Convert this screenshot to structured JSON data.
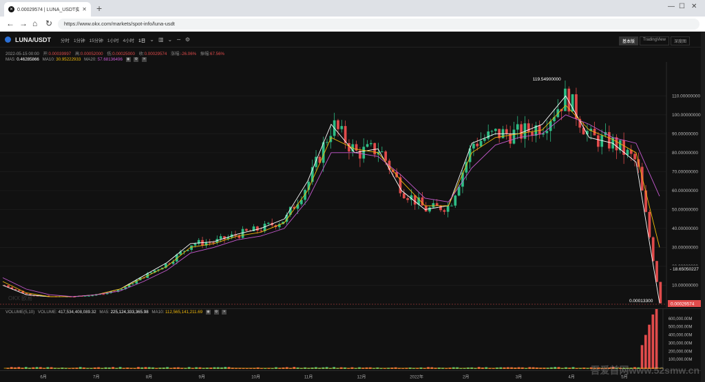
{
  "browser": {
    "tab_title": "0.00029574 | LUNA_USDT实时行情",
    "url": "https://www.okx.com/markets/spot-info/luna-usdt",
    "new_tab": "+",
    "minimize": "—",
    "maximize": "☐",
    "close": "✕"
  },
  "toolbar": {
    "symbol": "LUNA/USDT",
    "intervals": [
      "分时",
      "1分钟",
      "15分钟",
      "1小时",
      "4小时",
      "1日"
    ],
    "active_interval": "1日",
    "views": [
      "基本版",
      "TradingView",
      "深度图"
    ],
    "active_view": "基本版"
  },
  "ohlc": {
    "date": "2022-05-15 00:00",
    "open_label": "开:",
    "open": "0.00039997",
    "high_label": "高:",
    "high": "0.00052000",
    "low_label": "低:",
    "low": "0.00025000",
    "close_label": "收:",
    "close": "0.00029574",
    "change_label": "涨幅:",
    "change": "-26.06%",
    "amp_label": "振幅:",
    "amp": "67.56%"
  },
  "ma": {
    "ma5_label": "MA5:",
    "ma5": "0.46285866",
    "ma10_label": "MA10:",
    "ma10": "30.95222933",
    "ma20_label": "MA20:",
    "ma20": "57.68136496"
  },
  "volume": {
    "label": "VOLUME(5,10)",
    "vol_label": "VOLUME:",
    "vol": "417,534,408,089.32",
    "ma5_label": "MA5:",
    "ma5": "225,124,333,365.98",
    "ma10_label": "MA10:",
    "ma10": "112,565,141,211.69"
  },
  "annotations": {
    "high_marker": "119.54900000",
    "low_marker": "0.00013300",
    "crosshair_price": "18.65050227",
    "last_price": "0.00029574"
  },
  "colors": {
    "up": "#2ebd85",
    "down": "#e04b4b",
    "ma5": "#ffffff",
    "ma10": "#f0b90b",
    "ma20": "#c85ad1"
  },
  "watermark": "OKX 欧易",
  "site_watermark": "吾爱首网www.52smw.cn",
  "chart_data": {
    "type": "line",
    "price_axis": [
      "110.00000000",
      "100.00000000",
      "90.00000000",
      "80.00000000",
      "70.00000000",
      "60.00000000",
      "50.00000000",
      "40.00000000",
      "30.00000000",
      "20.00000000",
      "10.00000000"
    ],
    "time_axis": [
      "6月",
      "7月",
      "8月",
      "9月",
      "10月",
      "11月",
      "12月",
      "2022年",
      "2月",
      "3月",
      "4月",
      "5月"
    ],
    "volume_axis": [
      "600,000.00M",
      "500,000.00M",
      "400,000.00M",
      "300,000.00M",
      "200,000.00M",
      "100,000.00M"
    ],
    "ylim": [
      0,
      125
    ],
    "series": [
      {
        "name": "MA5",
        "color": "#ffffff",
        "values": [
          10,
          5,
          4,
          4,
          5,
          8,
          15,
          22,
          32,
          33,
          37,
          40,
          45,
          65,
          95,
          80,
          82,
          60,
          50,
          52,
          85,
          90,
          90,
          95,
          110,
          88,
          85,
          75,
          0.5
        ]
      },
      {
        "name": "MA10",
        "color": "#f0b90b",
        "values": [
          12,
          6,
          4,
          4,
          5,
          8,
          14,
          20,
          30,
          32,
          36,
          38,
          43,
          60,
          88,
          82,
          80,
          65,
          52,
          52,
          80,
          88,
          90,
          92,
          105,
          92,
          87,
          80,
          30
        ]
      },
      {
        "name": "MA20",
        "color": "#c85ad1",
        "values": [
          14,
          8,
          5,
          4,
          5,
          7,
          12,
          18,
          27,
          30,
          34,
          36,
          40,
          55,
          80,
          80,
          78,
          68,
          56,
          54,
          72,
          84,
          88,
          90,
          100,
          95,
          88,
          85,
          57
        ]
      }
    ]
  }
}
